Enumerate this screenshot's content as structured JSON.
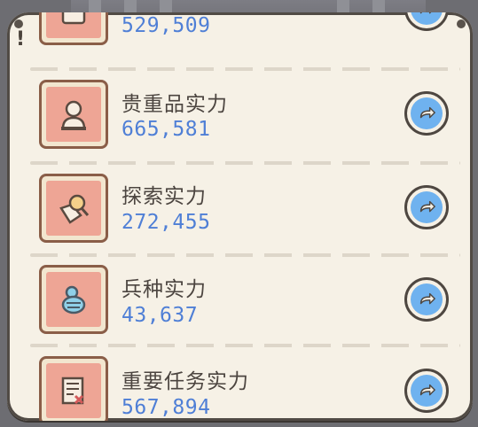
{
  "rows": [
    {
      "title": "",
      "value": "529,509",
      "icon": "scroll-icon"
    },
    {
      "title": "贵重品实力",
      "value": "665,581",
      "icon": "bust-icon"
    },
    {
      "title": "探索实力",
      "value": "272,455",
      "icon": "magnifier-icon"
    },
    {
      "title": "兵种实力",
      "value": "43,637",
      "icon": "soldier-icon"
    },
    {
      "title": "重要任务实力",
      "value": "567,894",
      "icon": "document-icon"
    }
  ],
  "panel": {
    "alert_mark": "!"
  },
  "colors": {
    "value": "#4f7fd6",
    "tile_bg": "#eea595",
    "go_button": "#6fb2ef",
    "panel_bg": "#f6f1e6"
  }
}
